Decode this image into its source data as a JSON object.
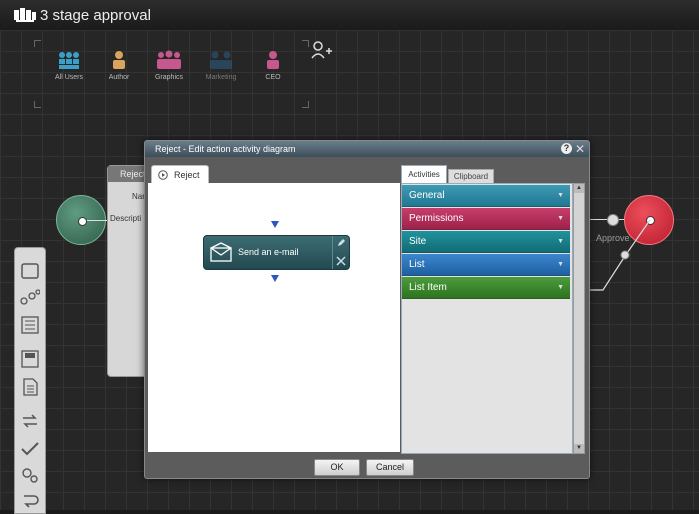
{
  "header": {
    "title": "3 stage approval"
  },
  "participants": [
    {
      "label": "All Users",
      "color": "#3aa0c8",
      "icon": "group-icon"
    },
    {
      "label": "Author",
      "color": "#d9a45c",
      "icon": "person-icon"
    },
    {
      "label": "Graphics",
      "color": "#c6588e",
      "icon": "group-icon"
    },
    {
      "label": "Marketing",
      "color": "#2b5f86",
      "icon": "group-icon"
    },
    {
      "label": "CEO",
      "color": "#c6588e",
      "icon": "person-icon"
    }
  ],
  "canvas": {
    "approve_label": "Approve",
    "bg_panel": {
      "head": "Reject",
      "name_label": "Nar",
      "desc_label": "Descripti"
    }
  },
  "modal": {
    "title": "Reject - Edit action activity diagram",
    "design_tab": "Reject",
    "action": {
      "label": "Send an e-mail"
    },
    "tabs": {
      "activities": "Activities",
      "clipboard": "Clipboard"
    },
    "categories": [
      {
        "label": "General",
        "color": "#2c8aa5"
      },
      {
        "label": "Permissions",
        "color": "#b32d5a"
      },
      {
        "label": "Site",
        "color": "#18808a"
      },
      {
        "label": "List",
        "color": "#2a73b8"
      },
      {
        "label": "List Item",
        "color": "#3b8a2c"
      }
    ],
    "ok": "OK",
    "cancel": "Cancel"
  }
}
